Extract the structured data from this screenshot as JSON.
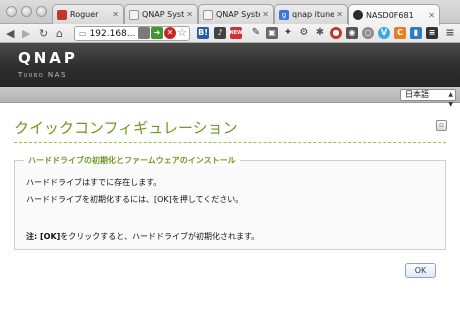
{
  "browser": {
    "tabs": [
      {
        "label": "Roguer",
        "favicon_color": "#c0392b"
      },
      {
        "label": "QNAP Syster",
        "favicon_color": "#eeeeee"
      },
      {
        "label": "QNAP Syster",
        "favicon_color": "#eeeeee"
      },
      {
        "label": "qnap itunes",
        "favicon_color": "#3a76d8"
      },
      {
        "label": "NASD0F681",
        "favicon_color": "#2a2a2a"
      }
    ],
    "url": "192.168..."
  },
  "header": {
    "logo": "QNAP",
    "subtitle": "Turbo NAS"
  },
  "language": {
    "selected": "日本語"
  },
  "page": {
    "title": "クイックコンフィギュレーション",
    "section_legend": "ハードドライブの初期化とファームウェアのインストール",
    "line1": "ハードドライブはすでに存在します。",
    "line2": "ハードドライブを初期化するには、[OK]を押してください。",
    "note_prefix": "注: [OK]",
    "note_rest": "をクリックすると、ハードドライブが初期化されます。",
    "ok_label": "OK"
  },
  "colors": {
    "accent_green": "#6c9a1f",
    "header_dark": "#2e2e2e"
  }
}
